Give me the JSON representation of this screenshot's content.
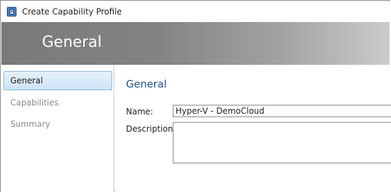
{
  "window": {
    "title": "Create Capability Profile",
    "icon": "capability-profile-icon"
  },
  "banner": {
    "title": "General"
  },
  "sidebar": {
    "items": [
      {
        "label": "General",
        "selected": true
      },
      {
        "label": "Capabilities",
        "selected": false
      },
      {
        "label": "Summary",
        "selected": false
      }
    ]
  },
  "content": {
    "section_title": "General",
    "name_label": "Name:",
    "name_value": "Hyper-V - DemoCloud",
    "description_label": "Description:",
    "description_value": ""
  },
  "colors": {
    "section_title": "#1d4e8f",
    "selected_nav_bg": "#d9eaf9",
    "banner_gray": "#7a7a7a"
  }
}
